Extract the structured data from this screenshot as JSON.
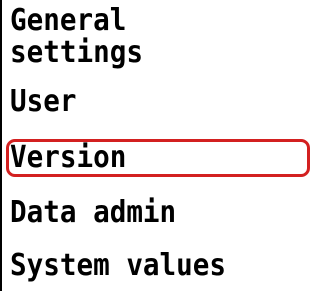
{
  "menu": {
    "items": [
      {
        "label_line1": "General",
        "label_line2": "settings"
      },
      {
        "label": "User"
      },
      {
        "label": "Version",
        "selected": true
      },
      {
        "label": "Data admin"
      },
      {
        "label": "System values"
      }
    ]
  },
  "colors": {
    "selection": "#d32020",
    "text": "#000000",
    "background": "#ffffff"
  }
}
